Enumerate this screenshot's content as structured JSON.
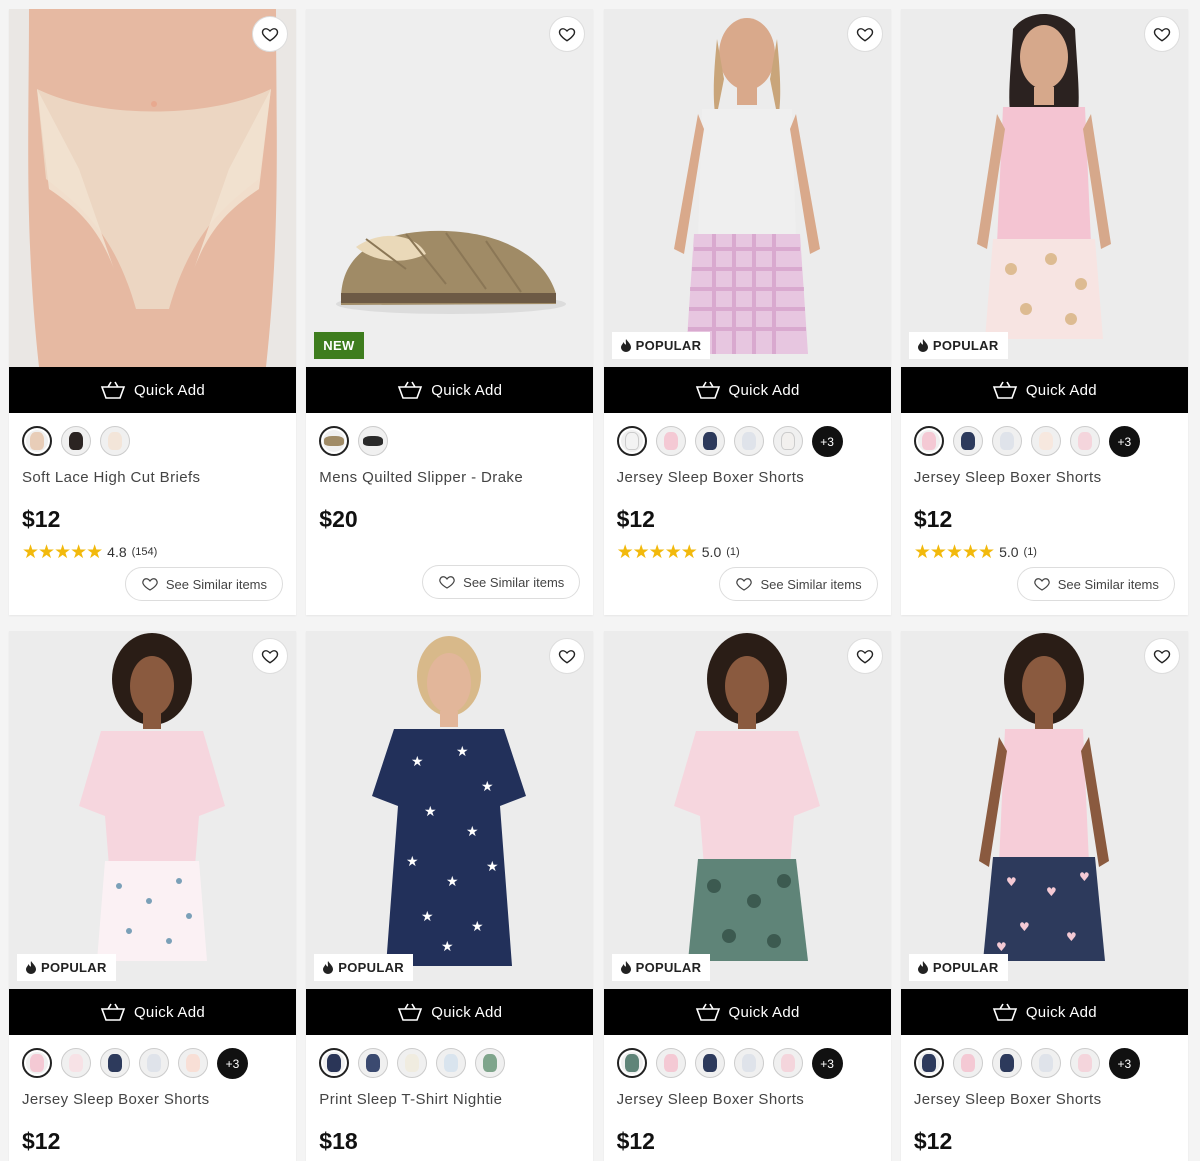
{
  "quick_add_label": "Quick Add",
  "see_similar_label": "See Similar items",
  "colors": {
    "new_badge": "#3e7d1e",
    "star": "#f2b90c",
    "quick_add_bg": "#000000"
  },
  "products": [
    {
      "name": "Soft Lace High Cut Briefs",
      "price": "$12",
      "badge": null,
      "rating": "4.8",
      "rating_count": "(154)",
      "swatches": [
        "#e8cdb8",
        "#2b2422",
        "#f3e5d9"
      ],
      "swatch_more": null
    },
    {
      "name": "Mens Quilted Slipper - Drake",
      "price": "$20",
      "badge": "NEW",
      "rating": null,
      "rating_count": null,
      "swatches": [
        "#a08b66",
        "#2a2a2a"
      ],
      "swatch_more": null
    },
    {
      "name": "Jersey Sleep Boxer Shorts",
      "price": "$12",
      "badge": "POPULAR",
      "rating": "5.0",
      "rating_count": "(1)",
      "swatches": [
        "#f3f3f3",
        "#f4c9d4",
        "#2d3a5c",
        "#dfe3ea",
        "#f2f0ee"
      ],
      "swatch_more": "+3"
    },
    {
      "name": "Jersey Sleep Boxer Shorts",
      "price": "$12",
      "badge": "POPULAR",
      "rating": "5.0",
      "rating_count": "(1)",
      "swatches": [
        "#f4c9d4",
        "#2d3a5c",
        "#dfe3ea",
        "#f7e8df",
        "#f4d5dc"
      ],
      "swatch_more": "+3"
    },
    {
      "name": "Jersey Sleep Boxer Shorts",
      "price": "$12",
      "badge": "POPULAR",
      "rating": null,
      "rating_count": null,
      "swatches": [
        "#f4c9d4",
        "#f7e2e6",
        "#2d3a5c",
        "#dfe3ea",
        "#f8dfd6"
      ],
      "swatch_more": "+3"
    },
    {
      "name": "Print Sleep T-Shirt Nightie",
      "price": "$18",
      "badge": "POPULAR",
      "rating": null,
      "rating_count": null,
      "swatches": [
        "#2a3557",
        "#3b4a70",
        "#f0ece0",
        "#d9e4ee",
        "#7fa58c"
      ],
      "swatch_more": null
    },
    {
      "name": "Jersey Sleep Boxer Shorts",
      "price": "$12",
      "badge": "POPULAR",
      "rating": null,
      "rating_count": null,
      "swatches": [
        "#5f8478",
        "#f4c9d4",
        "#2d3a5c",
        "#dfe3ea",
        "#f4d5dc"
      ],
      "swatch_more": "+3"
    },
    {
      "name": "Jersey Sleep Boxer Shorts",
      "price": "$12",
      "badge": "POPULAR",
      "rating": null,
      "rating_count": null,
      "swatches": [
        "#2d3a5c",
        "#f4c9d4",
        "#2d3a5c",
        "#dfe3ea",
        "#f4d5dc"
      ],
      "swatch_more": "+3"
    }
  ]
}
